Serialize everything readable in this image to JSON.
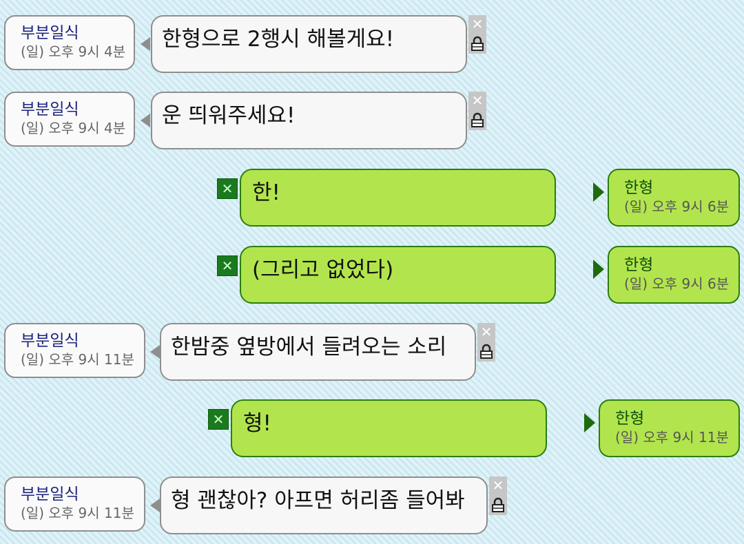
{
  "messages": [
    {
      "direction": "incoming",
      "sender": "부분일식",
      "time": "(일) 오후 9시 4분",
      "text": "한형으로 2행시 해볼게요!"
    },
    {
      "direction": "incoming",
      "sender": "부분일식",
      "time": "(일) 오후 9시 4분",
      "text": "운 띄워주세요!"
    },
    {
      "direction": "outgoing",
      "sender": "한형",
      "time": "(일) 오후 9시 6분",
      "text": "한!"
    },
    {
      "direction": "outgoing",
      "sender": "한형",
      "time": "(일) 오후 9시 6분",
      "text": "(그리고 없었다)"
    },
    {
      "direction": "incoming",
      "sender": "부분일식",
      "time": "(일) 오후 9시 11분",
      "text": "한밤중 옆방에서 들려오는 소리"
    },
    {
      "direction": "outgoing",
      "sender": "한형",
      "time": "(일) 오후 9시 11분",
      "text": "형!"
    },
    {
      "direction": "incoming",
      "sender": "부분일식",
      "time": "(일) 오후 9시 11분",
      "text": "형 괜찮아? 아프면 허리좀 들어봐"
    }
  ],
  "icons": {
    "delete_icon": "close-icon",
    "lock_icon": "lock-icon",
    "delete_glyph": "✕"
  },
  "colors": {
    "background": "#d7eef6",
    "incoming_bubble": "#f7f7f7",
    "outgoing_bubble": "#b2e54d",
    "sender_incoming": "#1a237e",
    "sender_outgoing": "#0d4d0d"
  }
}
